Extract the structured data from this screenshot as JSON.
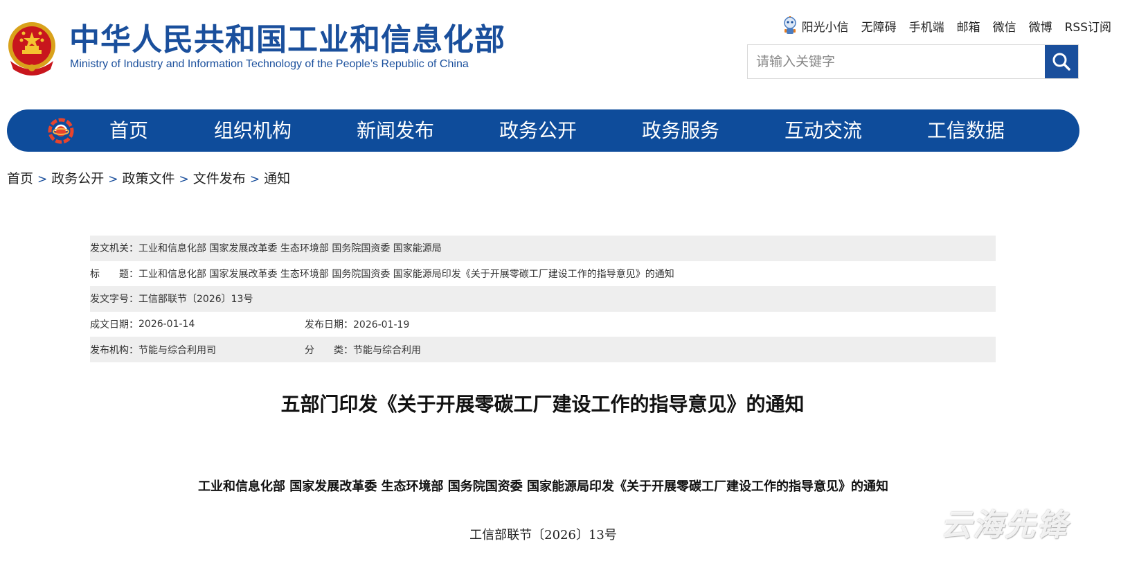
{
  "site": {
    "name_cn": "中华人民共和国工业和信息化部",
    "name_en": "Ministry of Industry and Information Technology of the People’s Republic of China",
    "emblem_icon": "national-emblem",
    "brand_color": "#1a4f9c"
  },
  "toplinks": [
    "阳光小信",
    "无障碍",
    "手机端",
    "邮箱",
    "微信",
    "微博",
    "RSS订阅"
  ],
  "search": {
    "placeholder": "请输入关键字",
    "button_icon": "search-icon"
  },
  "nav": {
    "logo_icon": "miit-logo-icon",
    "items": [
      "首页",
      "组织机构",
      "新闻发布",
      "政务公开",
      "政务服务",
      "互动交流",
      "工信数据"
    ],
    "bg_color": "#0e4c9b"
  },
  "breadcrumb": [
    "首页",
    "政务公开",
    "政策文件",
    "文件发布",
    "通知"
  ],
  "breadcrumb_sep": ">",
  "meta": {
    "issuer_label": "发文机关：",
    "issuer": "工业和信息化部 国家发展改革委 生态环境部 国务院国资委 国家能源局",
    "title_label": "标　　题：",
    "title": "工业和信息化部 国家发展改革委 生态环境部 国务院国资委 国家能源局印发《关于开展零碳工厂建设工作的指导意见》的通知",
    "docno_label": "发文字号：",
    "docno": "工信部联节〔2026〕13号",
    "created_label": "成文日期：",
    "created": "2026-01-14",
    "published_label": "发布日期：",
    "published": "2026-01-19",
    "org_label": "发布机构：",
    "org": "节能与综合利用司",
    "category_label": "分　　类：",
    "category": "节能与综合利用"
  },
  "document": {
    "title": "五部门印发《关于开展零碳工厂建设工作的指导意见》的通知",
    "heading": "工业和信息化部 国家发展改革委 生态环境部 国务院国资委 国家能源局印发《关于开展零碳工厂建设工作的指导意见》的通知",
    "code": "工信部联节〔2026〕13号"
  },
  "watermark": "云海先锋"
}
